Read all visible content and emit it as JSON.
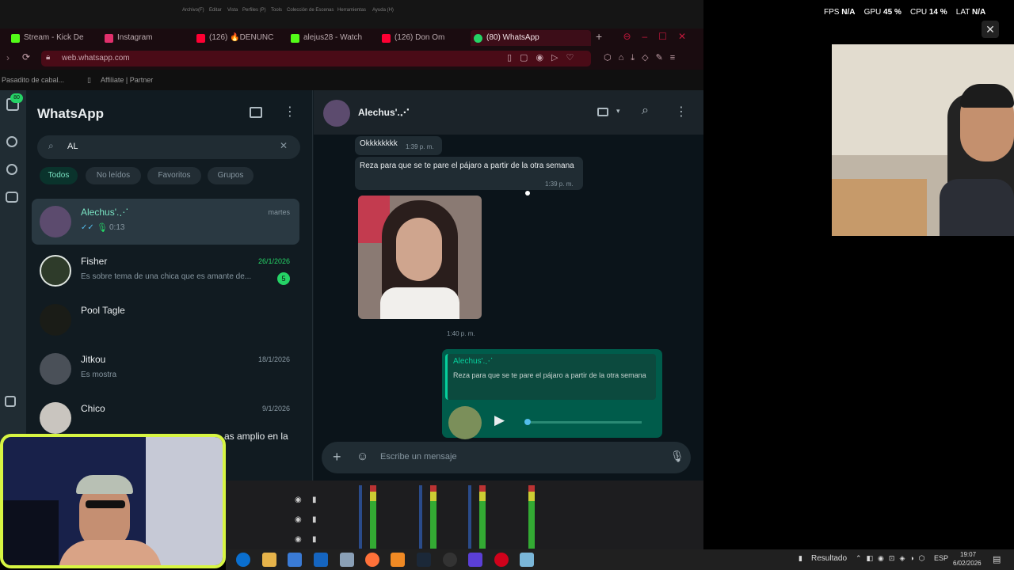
{
  "browser": {
    "os_menu": [
      "Archivo(F)",
      "Editar",
      "Vista",
      "Perfiles (P)",
      "Tools",
      "Colección de Escenas",
      "Herramientas",
      "Ayuda (H)"
    ],
    "tabs": [
      {
        "label": "Stream - Kick De",
        "color": "#53fc18"
      },
      {
        "label": "Instagram",
        "color": "#e1306c"
      },
      {
        "label": "(126) 🔥DENUNC",
        "color": "#ff0033"
      },
      {
        "label": "alejus28 - Watch",
        "color": "#53fc18"
      },
      {
        "label": "(126) Don Om",
        "color": "#ff0033"
      },
      {
        "label": "(80) WhatsApp",
        "color": "#25d366"
      }
    ],
    "url": "web.whatsapp.com",
    "bookmarks": [
      "Pasadito de cabal...",
      "Affiliate | Partner"
    ]
  },
  "whatsapp": {
    "title": "WhatsApp",
    "search_value": "AL",
    "filters": [
      "Todos",
      "No leídos",
      "Favoritos",
      "Grupos"
    ],
    "chats": [
      {
        "name": "Alechus'.⋰",
        "sub": "0:13",
        "date": "martes",
        "avatar": "#5c4b6e"
      },
      {
        "name": "Fisher",
        "sub": "Es sobre tema de una chica que es amante de...",
        "date": "26/1/2026",
        "badge": "5",
        "avatar": "#2e3b2a"
      },
      {
        "name": "Pool Tagle",
        "sub": "",
        "date": "",
        "avatar": "#1a1c17"
      },
      {
        "name": "Jitkou",
        "sub": "Es mostra",
        "date": "18/1/2026",
        "avatar": "#4a5058"
      },
      {
        "name": "Chico",
        "sub": "",
        "date": "9/1/2026",
        "avatar": "#c9c5bf"
      }
    ],
    "partial_preview": "as amplio en la",
    "chat": {
      "contact": "Alechus'.⋰",
      "messages": [
        {
          "text": "Okkkkkkkk",
          "time": "1:39 p. m."
        },
        {
          "text": "Reza para que se te pare el pájaro a partir de la otra semana",
          "time": "1:39 p. m."
        },
        {
          "time": "1:40 p. m."
        }
      ],
      "reply": {
        "quoted_name": "Alechus'.⋰",
        "quoted_text": "Reza para que se te pare el pájaro a partir de la otra semana"
      },
      "composer_placeholder": "Escribe un mensaje"
    }
  },
  "overlay": {
    "fps_label": "FPS",
    "fps": "N/A",
    "gpu_label": "GPU",
    "gpu": "45 %",
    "cpu_label": "CPU",
    "cpu": "14 %",
    "lat_label": "LAT",
    "lat": "N/A"
  },
  "taskbar": {
    "result": "Resultado",
    "lang": "ESP",
    "time": "19:07",
    "date": "6/02/2026"
  },
  "colors": {
    "accent": "#00a884",
    "outgoing": "#005c4b",
    "incoming": "#202c33",
    "browser_accent": "#c2183c",
    "facecam_border": "#d7f542"
  }
}
